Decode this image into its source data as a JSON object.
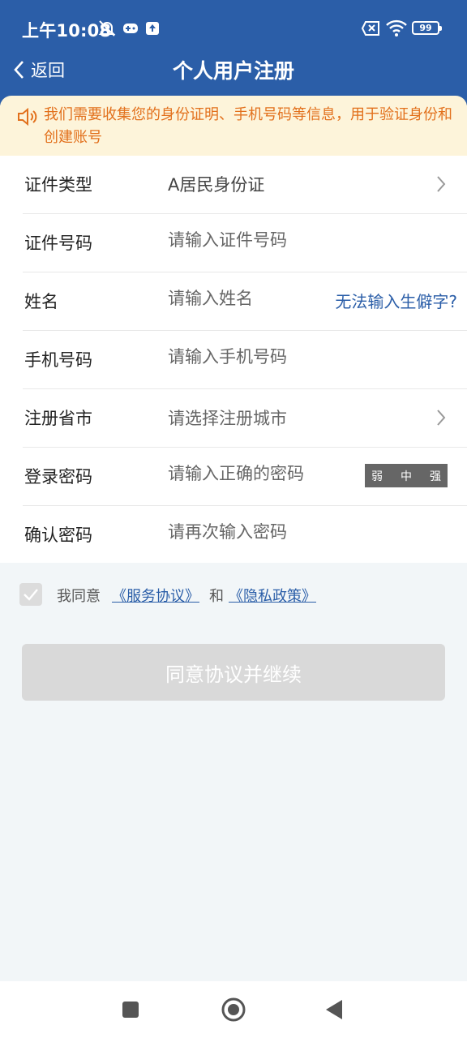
{
  "status_bar": {
    "time": "上午10:08",
    "battery": "99",
    "icons": [
      "mute-bell-icon",
      "gamepad-icon",
      "upload-icon",
      "sim-off-icon",
      "wifi-icon",
      "battery-icon"
    ]
  },
  "header": {
    "back_label": "返回",
    "title": "个人用户注册"
  },
  "notice": {
    "text": "我们需要收集您的身份证明、手机号码等信息，用于验证身份和创建账号",
    "color": "#e2701c"
  },
  "form": {
    "rows": [
      {
        "label": "证件类型",
        "value": "A居民身份证"
      },
      {
        "label": "证件号码",
        "placeholder": "请输入证件号码"
      },
      {
        "label": "姓名",
        "placeholder": "请输入姓名",
        "extra_link": "无法输入生僻字?"
      },
      {
        "label": "手机号码",
        "placeholder": "请输入手机号码"
      },
      {
        "label": "注册省市",
        "value": "请选择注册城市"
      },
      {
        "label": "登录密码",
        "placeholder": "请输入正确的密码",
        "strength": [
          "弱",
          "中",
          "强"
        ]
      },
      {
        "label": "确认密码",
        "placeholder": "请再次输入密码"
      }
    ]
  },
  "agreement": {
    "prefix": "我同意",
    "service_link": "《服务协议》",
    "and": "和",
    "privacy_link": "《隐私政策》",
    "checked": true
  },
  "continue_button": "同意协议并继续",
  "colors": {
    "brand": "#2b5ea8",
    "notice_bg": "#fdf4da",
    "button_disabled": "#d9d9d9"
  }
}
